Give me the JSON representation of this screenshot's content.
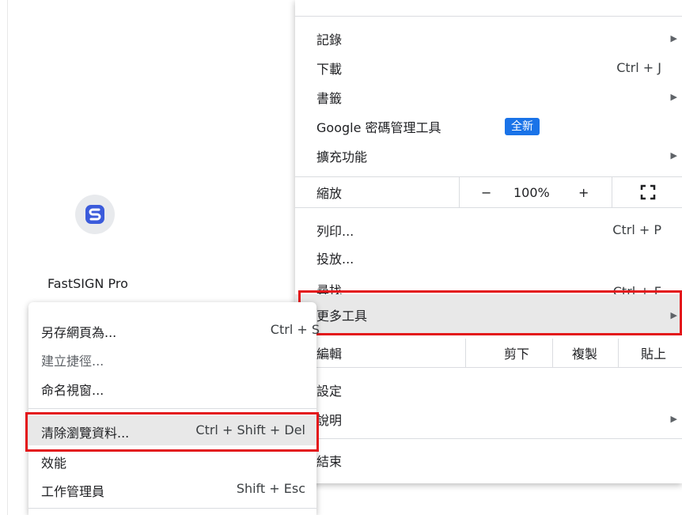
{
  "page": {
    "app_name": "FastSIGN Pro"
  },
  "menu": {
    "history": "記錄",
    "downloads": "下載",
    "downloads_shortcut": "Ctrl + J",
    "bookmarks": "書籤",
    "password_manager": "Google 密碼管理工具",
    "password_badge": "全新",
    "extensions": "擴充功能",
    "zoom_label": "縮放",
    "zoom_minus": "−",
    "zoom_value": "100%",
    "zoom_plus": "+",
    "print": "列印...",
    "print_shortcut": "Ctrl + P",
    "cast": "投放...",
    "find": "尋找",
    "find_shortcut": "Ctrl + F",
    "more_tools": "更多工具",
    "edit_label": "編輯",
    "cut": "剪下",
    "copy": "複製",
    "paste": "貼上",
    "settings": "設定",
    "help": "說明",
    "exit": "結束"
  },
  "submenu": {
    "save_page": "另存網頁為...",
    "save_page_shortcut": "Ctrl + S",
    "create_shortcut": "建立捷徑...",
    "name_window": "命名視窗...",
    "clear_data": "清除瀏覽資料...",
    "clear_data_shortcut": "Ctrl + Shift + Del",
    "performance": "效能",
    "task_manager": "工作管理員",
    "task_manager_shortcut": "Shift + Esc"
  },
  "colors": {
    "highlight_box": "#e3171b",
    "badge": "#1a73e8",
    "app_logo": "#3b5bdb"
  }
}
